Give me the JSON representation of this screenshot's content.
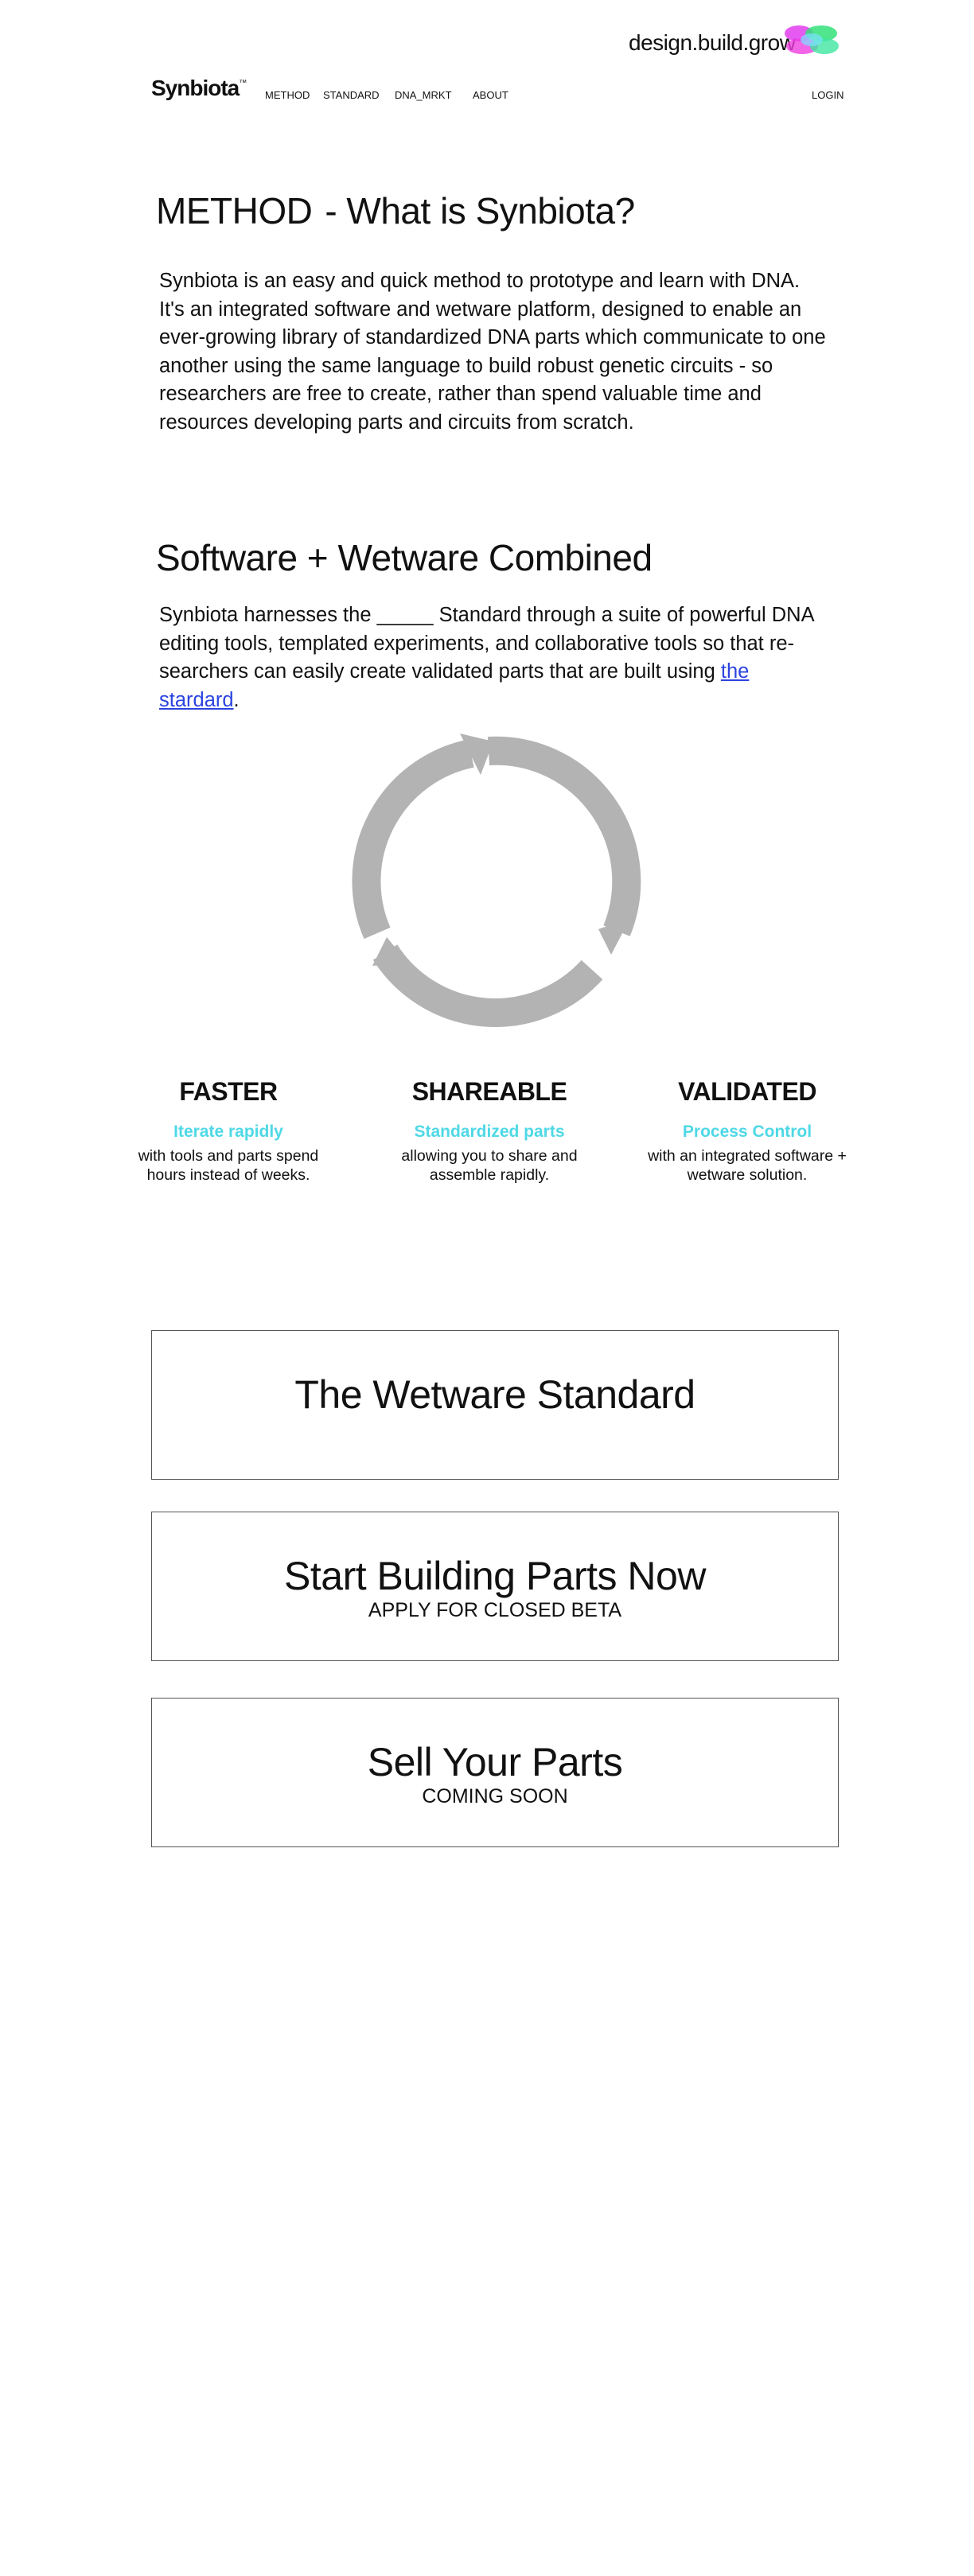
{
  "header": {
    "tagline": "design.build.grow",
    "brand": "Synbiota",
    "brand_mark": "™",
    "nav": [
      "METHOD",
      "STANDARD",
      "DNA_MRKT",
      "ABOUT"
    ],
    "login": "LOGIN"
  },
  "method": {
    "title_left": "METHOD",
    "title_right": "- What is Synbiota?",
    "body": "Synbiota is an easy and quick method to prototype and learn with DNA. It's an integrated software and wetware platform, designed to enable an ever-growing library of standardized DNA parts which communicate to one another using the same language to build robust genetic circuits - so researchers are free to create, rather than spend valuable time and resources developing parts and circuits from scratch."
  },
  "combined": {
    "title": "Software + Wetware Combined",
    "body": "Synbiota harnesses the _____ Standard through a suite of powerful DNA editing tools, templated experiments, and collaborative tools so that re-searchers can easily create validated parts that are built using ",
    "link": "the stardard",
    "period": "."
  },
  "features": [
    {
      "title": "FASTER",
      "subtitle": "Iterate rapidly",
      "desc": "with tools and parts spend hours instead of weeks."
    },
    {
      "title": "SHAREABLE",
      "subtitle": "Standardized parts",
      "desc": "allowing you to share and assemble rapidly."
    },
    {
      "title": "VALIDATED",
      "subtitle": "Process Control",
      "desc": "with an integrated software + wetware solution."
    }
  ],
  "cards": [
    {
      "title": "The Wetware Standard",
      "subtitle": ""
    },
    {
      "title": "Start Building Parts Now",
      "subtitle": "APPLY FOR CLOSED BETA"
    },
    {
      "title": "Sell Your Parts",
      "subtitle": "COMING SOON"
    }
  ],
  "colors": {
    "accent": "#4fd8e6",
    "link": "#2b44e0",
    "cycle": "#b3b3b3"
  }
}
